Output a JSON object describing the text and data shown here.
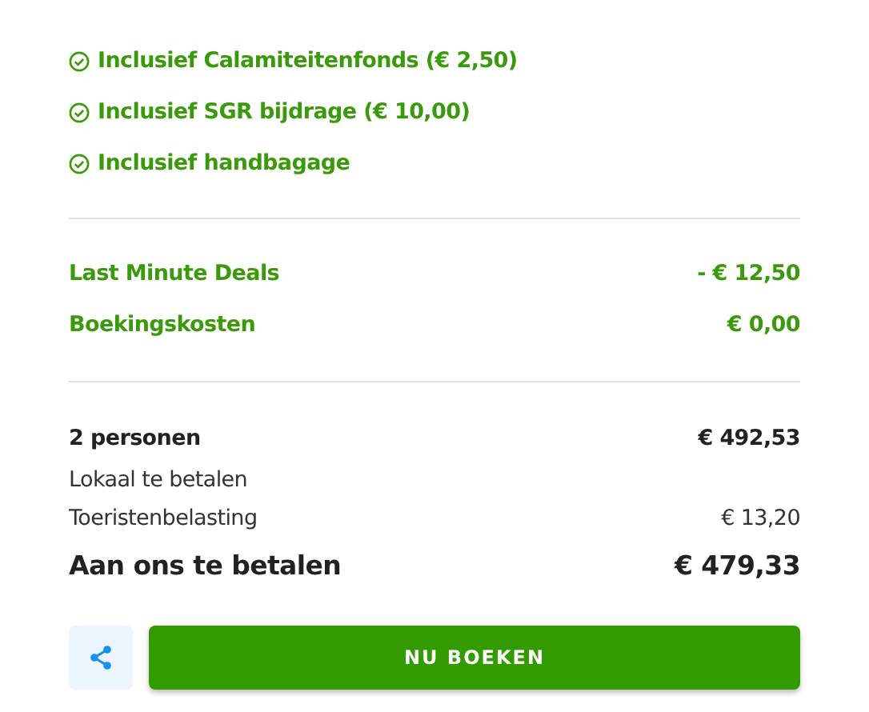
{
  "inclusions": [
    "Inclusief Calamiteitenfonds (€ 2,50)",
    "Inclusief SGR bijdrage (€ 10,00)",
    "Inclusief handbagage"
  ],
  "adjustments": [
    {
      "label": "Last Minute Deals",
      "amount": "- € 12,50"
    },
    {
      "label": "Boekingskosten",
      "amount": "€ 0,00"
    }
  ],
  "summary": [
    {
      "kind": "subtotal",
      "label": "2 personen",
      "amount": "€ 492,53"
    },
    {
      "kind": "plain",
      "label": "Lokaal te betalen"
    },
    {
      "kind": "plain",
      "label": "Toeristenbelasting",
      "amount": "€ 13,20"
    },
    {
      "kind": "total",
      "label": "Aan ons te betalen",
      "amount": "€ 479,33"
    }
  ],
  "book_button": "NU BOEKEN"
}
